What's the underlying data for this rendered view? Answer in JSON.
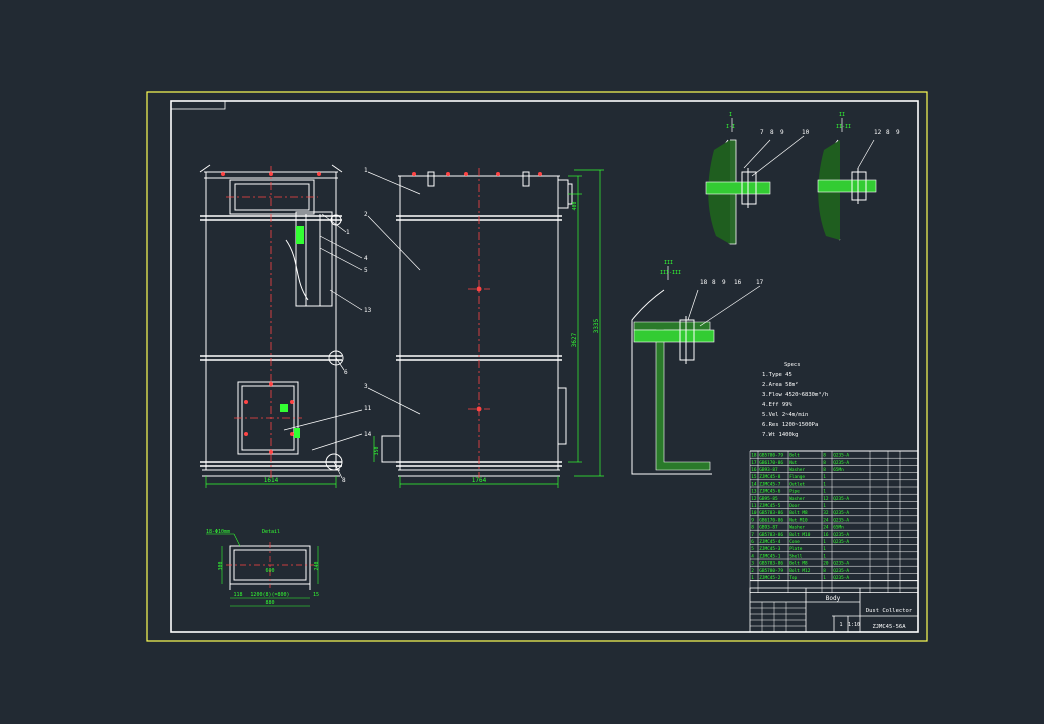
{
  "drawing": {
    "dims": {
      "left_width": "1614",
      "mid_width": "1764",
      "height_a": "3627",
      "height_b": "3335",
      "small_h": "350",
      "top_r": "400",
      "detail_a": "600",
      "detail_b": "1200(8)(=800)",
      "detail_c": "880",
      "detail_d": "118",
      "detail_e": "15",
      "detail_f": "300",
      "detail_g": "240"
    },
    "detail_title": "18-Φ10mm",
    "detail_caption": "Detail",
    "balloons_left": [
      "1",
      "4",
      "5",
      "13",
      "6",
      "11",
      "14",
      "8"
    ],
    "balloons_mid": [
      "1",
      "2",
      "3"
    ],
    "section_labels": [
      "I",
      "I-I",
      "II",
      "II-II",
      "III",
      "III-III"
    ],
    "section_balloons": [
      "7",
      "8",
      "9",
      "10",
      "12",
      "8",
      "9",
      "18",
      "8",
      "9",
      "16",
      "17"
    ],
    "specs_title": "Specs",
    "specs": [
      "1.Type  45",
      "2.Area  58m²",
      "3.Flow  4520~6830m³/h",
      "4.Eff  99%",
      "5.Vel  2~4m/min",
      "6.Res  1200~1500Pa",
      "7.Wt  1400kg"
    ],
    "title_block": {
      "name": "Body",
      "company": "Dust Collector",
      "code": "ZJMC45-56A",
      "scale": "1:10",
      "qty": "1"
    },
    "bom_rows": [
      [
        "1",
        "ZJMC45-2",
        "Top",
        "1",
        "Q235-A",
        "",
        ""
      ],
      [
        "2",
        "GB5780-79",
        "Bolt M12",
        "8",
        "Q235-A",
        "",
        ""
      ],
      [
        "3",
        "GB5783-86",
        "Bolt M8",
        "20",
        "Q235-A",
        "",
        ""
      ],
      [
        "4",
        "ZJMC45-1",
        "Shell",
        "1",
        "",
        "",
        ""
      ],
      [
        "5",
        "ZJMC45-3",
        "Plate",
        "1",
        "",
        "",
        ""
      ],
      [
        "6",
        "ZJMC45-4",
        "Cone",
        "1",
        "Q235-A",
        "",
        ""
      ],
      [
        "7",
        "GB5783-86",
        "Bolt M10",
        "16",
        "Q235-A",
        "",
        ""
      ],
      [
        "8",
        "GB93-87",
        "Washer",
        "24",
        "65Mn",
        "",
        ""
      ],
      [
        "9",
        "GB6170-86",
        "Nut M10",
        "24",
        "Q235-A",
        "",
        ""
      ],
      [
        "10",
        "GB5783-86",
        "Bolt M8",
        "32",
        "Q235-A",
        "",
        ""
      ],
      [
        "11",
        "ZJMC45-5",
        "Door",
        "1",
        "",
        "",
        ""
      ],
      [
        "12",
        "GB95-85",
        "Washer",
        "12",
        "Q235-A",
        "",
        ""
      ],
      [
        "13",
        "ZJMC45-6",
        "Pipe",
        "1",
        "",
        "",
        ""
      ],
      [
        "14",
        "ZJMC45-7",
        "Outlet",
        "1",
        "",
        "",
        ""
      ],
      [
        "15",
        "ZJMC45-8",
        "Flange",
        "1",
        "",
        "",
        ""
      ],
      [
        "16",
        "GB93-87",
        "Washer",
        "8",
        "65Mn",
        "",
        ""
      ],
      [
        "17",
        "GB6170-86",
        "Nut",
        "8",
        "Q235-A",
        "",
        ""
      ],
      [
        "18",
        "GB5780-79",
        "Bolt",
        "8",
        "Q235-A",
        "",
        ""
      ]
    ]
  }
}
